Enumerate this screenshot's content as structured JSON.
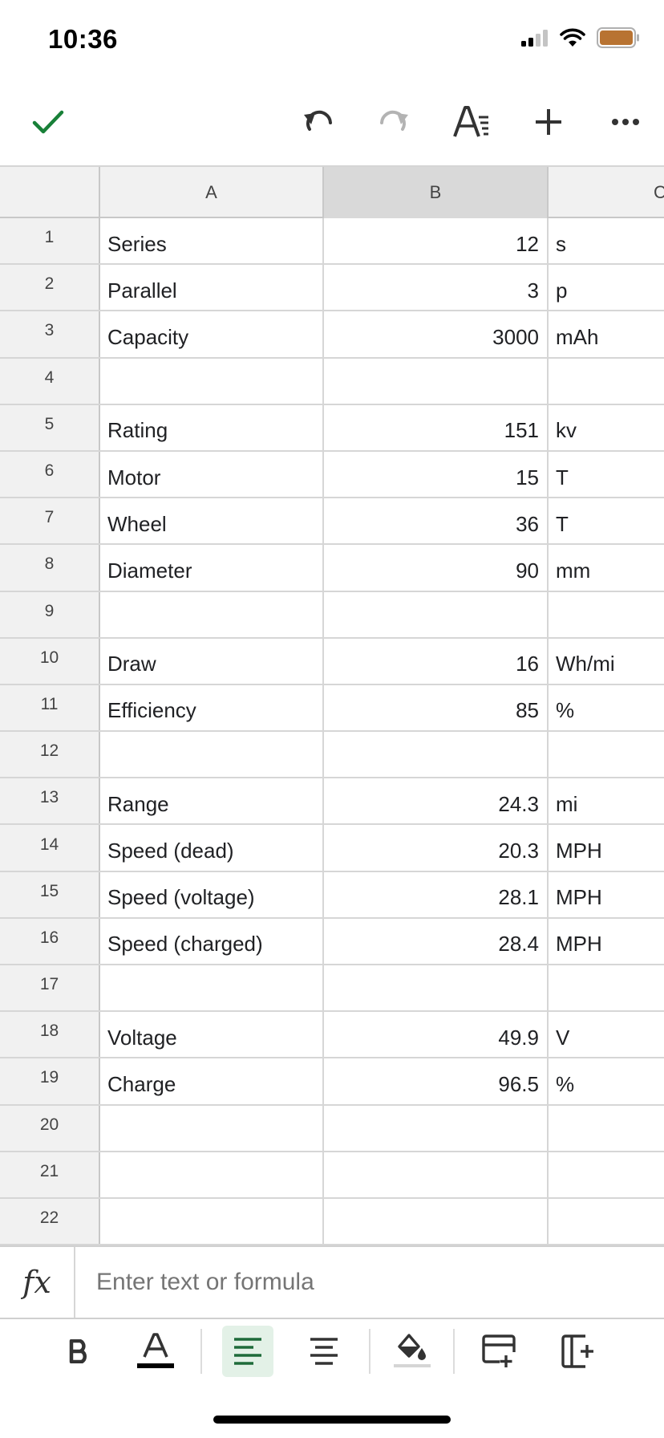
{
  "status_bar": {
    "time": "10:36",
    "icons": [
      "cellular-signal-icon",
      "wifi-icon",
      "battery-icon"
    ],
    "battery_color": "#b87332"
  },
  "toolbar": {
    "items": [
      "checkmark-icon",
      "undo-icon",
      "redo-icon",
      "text-format-icon",
      "add-icon",
      "more-icon"
    ],
    "accent_color": "#188038"
  },
  "sheet": {
    "columns": [
      "A",
      "B",
      "C"
    ],
    "selected_column": "B",
    "rows": [
      {
        "num": "1",
        "a": "Series",
        "b": "12",
        "c": "s"
      },
      {
        "num": "2",
        "a": "Parallel",
        "b": "3",
        "c": "p"
      },
      {
        "num": "3",
        "a": "Capacity",
        "b": "3000",
        "c": "mAh"
      },
      {
        "num": "4",
        "a": "",
        "b": "",
        "c": ""
      },
      {
        "num": "5",
        "a": "Rating",
        "b": "151",
        "c": "kv"
      },
      {
        "num": "6",
        "a": "Motor",
        "b": "15",
        "c": "T"
      },
      {
        "num": "7",
        "a": "Wheel",
        "b": "36",
        "c": "T"
      },
      {
        "num": "8",
        "a": "Diameter",
        "b": "90",
        "c": "mm"
      },
      {
        "num": "9",
        "a": "",
        "b": "",
        "c": ""
      },
      {
        "num": "10",
        "a": "Draw",
        "b": "16",
        "c": "Wh/mi"
      },
      {
        "num": "11",
        "a": "Efficiency",
        "b": "85",
        "c": "%"
      },
      {
        "num": "12",
        "a": "",
        "b": "",
        "c": ""
      },
      {
        "num": "13",
        "a": "Range",
        "b": "24.3",
        "c": "mi"
      },
      {
        "num": "14",
        "a": "Speed (dead)",
        "b": "20.3",
        "c": "MPH"
      },
      {
        "num": "15",
        "a": "Speed (voltage)",
        "b": "28.1",
        "c": "MPH"
      },
      {
        "num": "16",
        "a": "Speed (charged)",
        "b": "28.4",
        "c": "MPH"
      },
      {
        "num": "17",
        "a": "",
        "b": "",
        "c": ""
      },
      {
        "num": "18",
        "a": "Voltage",
        "b": "49.9",
        "c": "V"
      },
      {
        "num": "19",
        "a": "Charge",
        "b": "96.5",
        "c": "%"
      },
      {
        "num": "20",
        "a": "",
        "b": "",
        "c": ""
      },
      {
        "num": "21",
        "a": "",
        "b": "",
        "c": ""
      },
      {
        "num": "22",
        "a": "",
        "b": "",
        "c": ""
      }
    ]
  },
  "formula_bar": {
    "fx_label": "fx",
    "placeholder": "Enter text or formula",
    "value": ""
  },
  "format_bar": {
    "items": [
      "bold-icon",
      "text-color-icon",
      "align-left-icon",
      "align-center-icon",
      "fill-color-icon",
      "insert-row-icon",
      "insert-column-icon"
    ],
    "active": "align-left-icon"
  }
}
